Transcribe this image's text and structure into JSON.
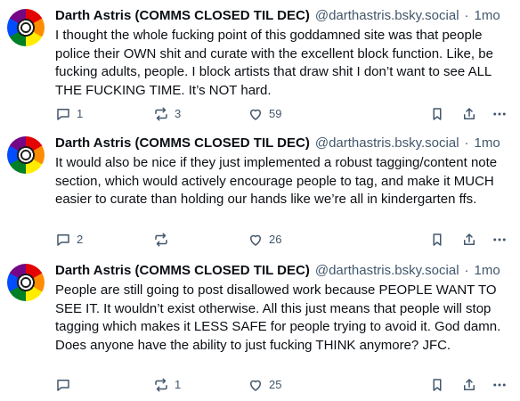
{
  "posts": [
    {
      "author_name": "Darth Astris (COMMS CLOSED TIL DEC)",
      "handle": "@darthastris.bsky.social",
      "separator": "·",
      "time": "1mo",
      "text": "I thought the whole fucking point of this goddamned site was that people police their OWN shit and curate with the excellent block function. Like, be fucking adults, people. I block artists that draw shit I don’t want to see ALL THE FUCKING TIME. It’s NOT hard.",
      "replies": "1",
      "reposts": "3",
      "likes": "59"
    },
    {
      "author_name": "Darth Astris (COMMS CLOSED TIL DEC)",
      "handle": "@darthastris.bsky.social",
      "separator": "·",
      "time": "1mo",
      "text": "It would also be nice if they just implemented a robust tagging/content note section, which would actively encourage people to tag, and make it MUCH easier to curate than holding our hands like we’re all in kindergarten ffs.",
      "replies": "2",
      "reposts": "",
      "likes": "26"
    },
    {
      "author_name": "Darth Astris (COMMS CLOSED TIL DEC)",
      "handle": "@darthastris.bsky.social",
      "separator": "·",
      "time": "1mo",
      "text": "People are still going to post disallowed work because PEOPLE WANT TO SEE IT. It wouldn’t exist otherwise. All this just means that people will stop tagging which makes it LESS SAFE for people trying to avoid it. God damn. Does anyone have the ability to just fucking THINK anymore? JFC.",
      "replies": "",
      "reposts": "1",
      "likes": "25"
    }
  ],
  "icons": {
    "reply": "speech-bubble-icon",
    "repost": "repost-arrows-icon",
    "like": "heart-icon",
    "bookmark": "bookmark-icon",
    "share": "share-icon",
    "more": "more-horizontal-icon"
  },
  "colors": {
    "text": "#0b0f14",
    "muted": "#42576c",
    "background": "#ffffff"
  }
}
